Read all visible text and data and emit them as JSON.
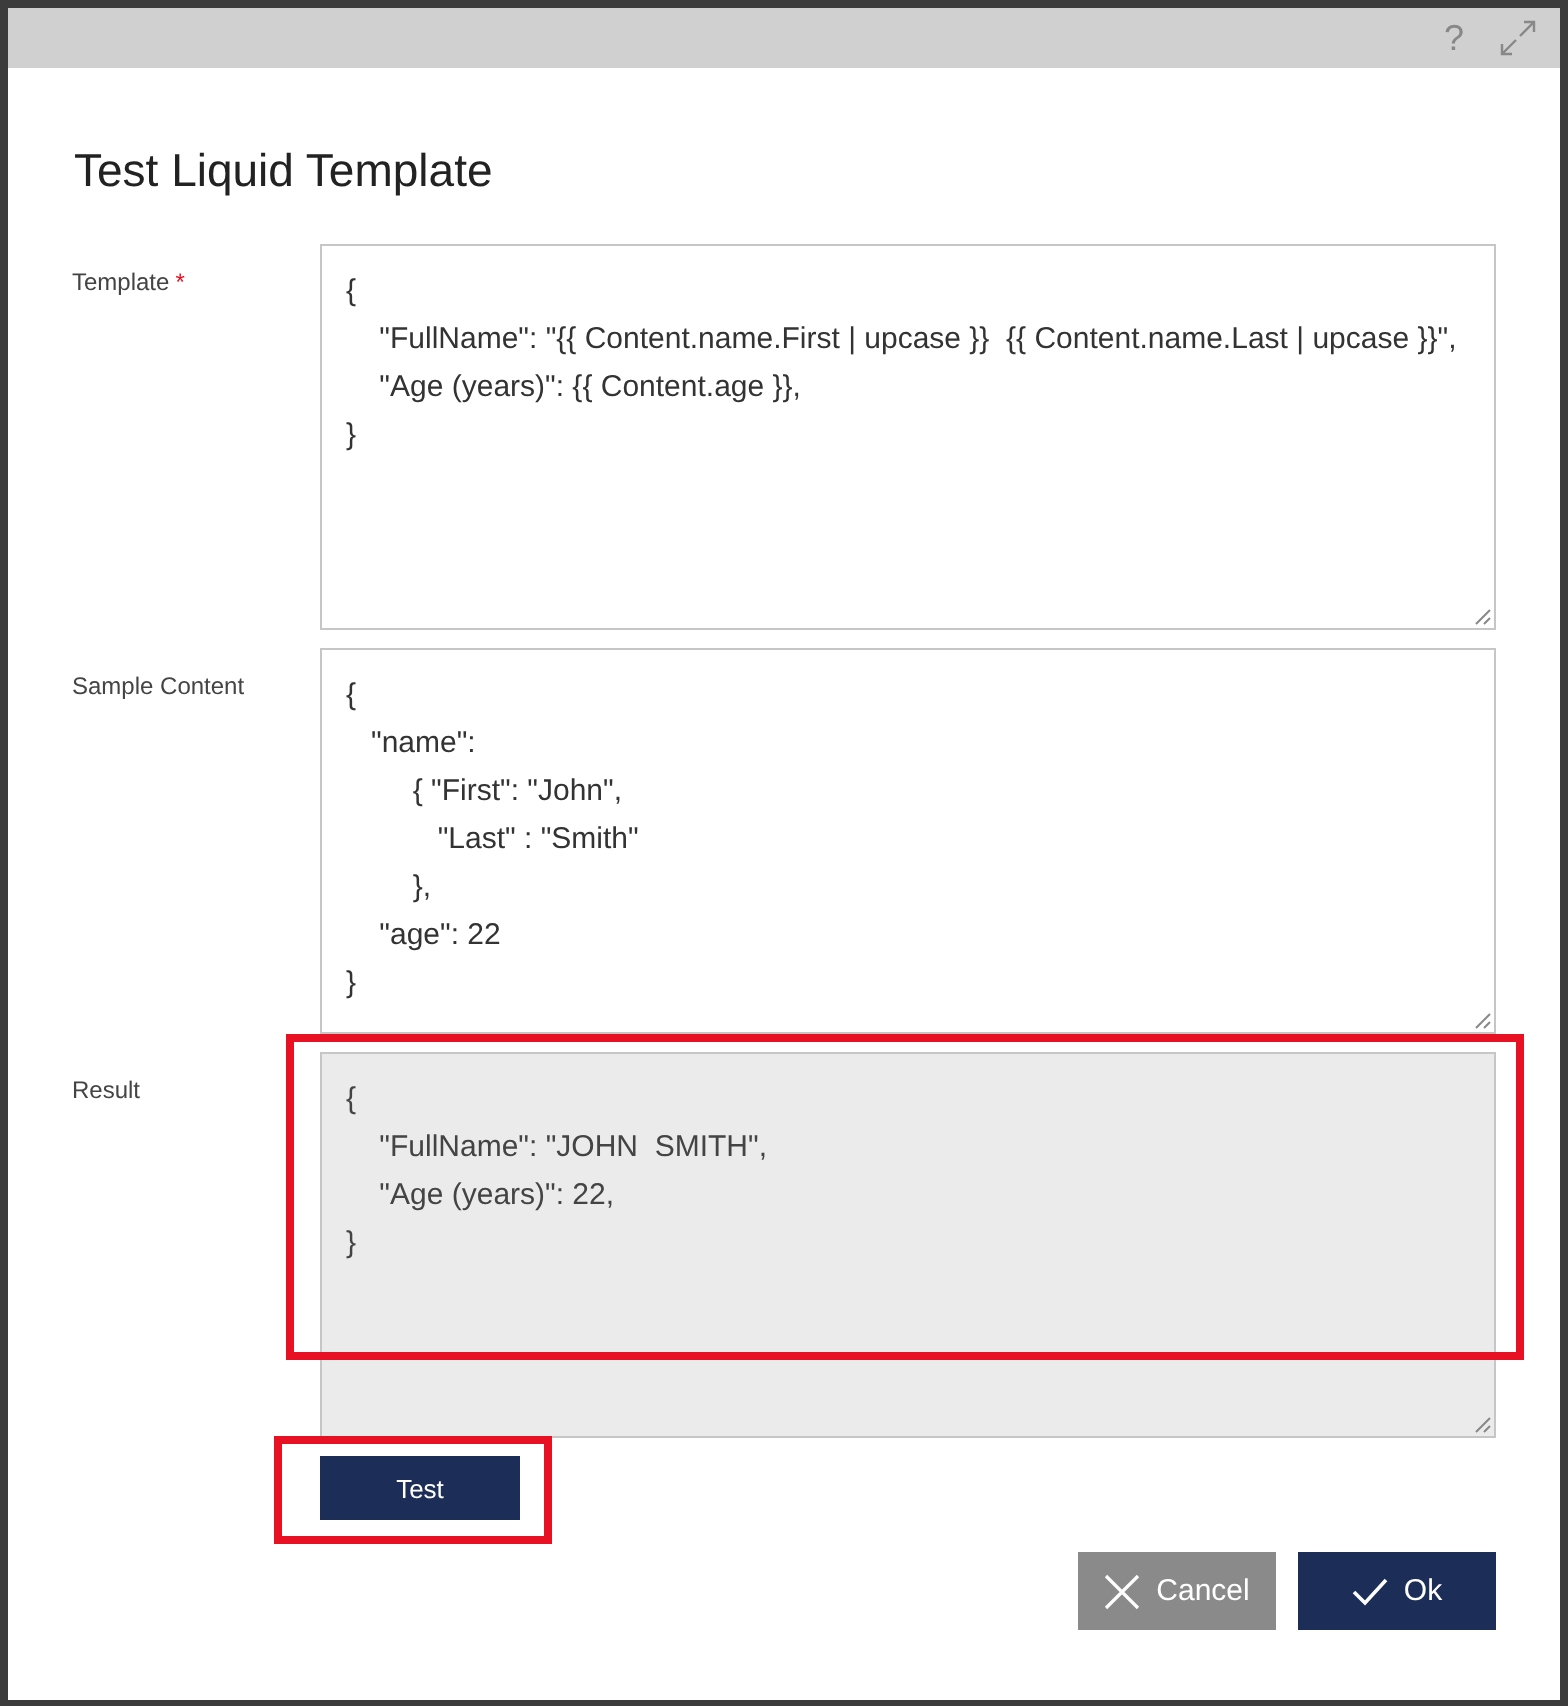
{
  "header": {
    "help": "?"
  },
  "title": "Test Liquid Template",
  "fields": [
    {
      "label": "Template",
      "required_mark": "*",
      "readonly": false,
      "highlighted": false,
      "value": "{\n    \"FullName\": \"{{ Content.name.First | upcase }}  {{ Content.name.Last | upcase }}\",\n    \"Age (years)\": {{ Content.age }},\n}"
    },
    {
      "label": "Sample Content",
      "readonly": false,
      "highlighted": false,
      "value": "{\n   \"name\":\n        { \"First\": \"John\",\n           \"Last\" : \"Smith\"\n        },\n    \"age\": 22\n}"
    },
    {
      "label": "Result",
      "readonly": true,
      "highlighted": true,
      "value": "{\n    \"FullName\": \"JOHN  SMITH\",\n    \"Age (years)\": 22,\n}"
    }
  ],
  "test_button": {
    "label": "Test",
    "highlighted": true
  },
  "actions": [
    {
      "kind": "cancel",
      "label": "Cancel"
    },
    {
      "kind": "ok",
      "label": "Ok"
    }
  ]
}
